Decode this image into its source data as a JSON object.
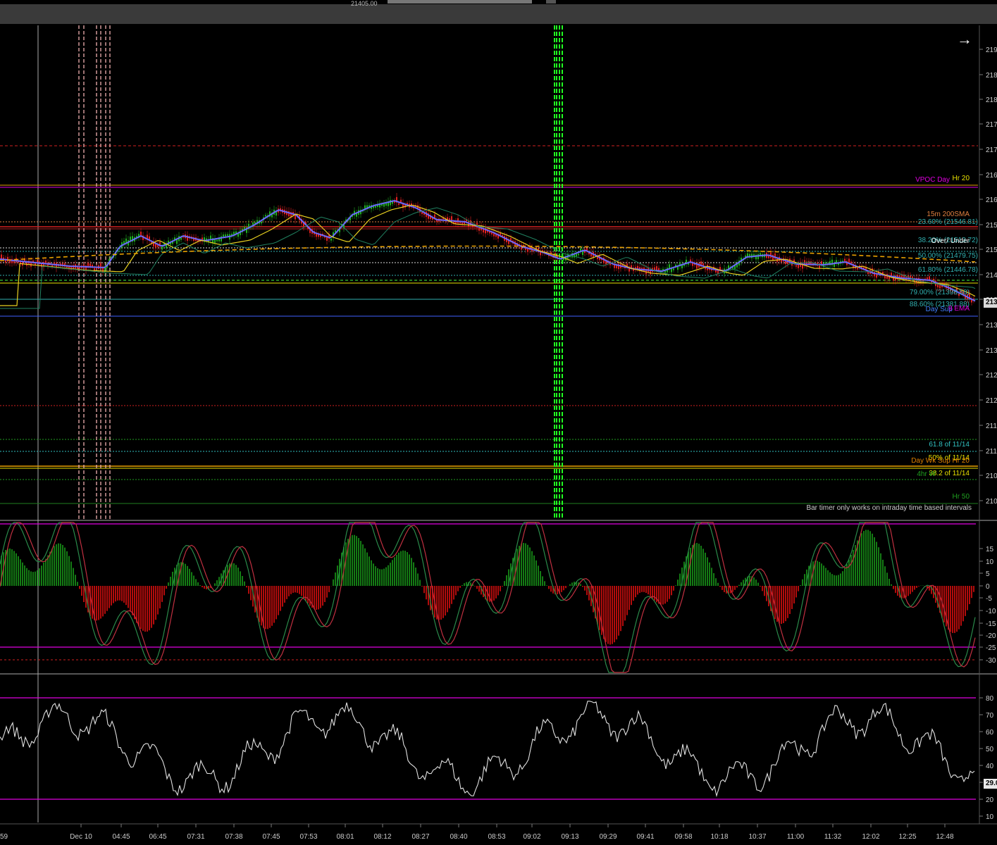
{
  "top_bar": {
    "price_readout": "21405.00"
  },
  "nav_arrow": "→",
  "bar_timer_notice": "Bar timer only works on intraday time based intervals",
  "price_badge": "213",
  "rsi_badge": "29.0",
  "left_edge_label": "59",
  "chart_data": [
    {
      "type": "line",
      "name": "price-panel",
      "y_axis_tick_labels": [
        "219",
        "218",
        "218",
        "217",
        "217",
        "216",
        "216",
        "215",
        "215",
        "214",
        "213",
        "213",
        "213",
        "212",
        "212",
        "211",
        "211",
        "210",
        "210"
      ],
      "price_level_labels": [
        {
          "text": "Hr 20",
          "color": "#e8e000"
        },
        {
          "text": "VPOC Day",
          "color": "#e000e0"
        },
        {
          "text": "15m 200SMA",
          "color": "#e08040"
        },
        {
          "text": "23.60% (21546.81)",
          "color": "#30b0b0"
        },
        {
          "text": "38.20% (21513.72)",
          "color": "#30b0b0"
        },
        {
          "text": "Over/ Under",
          "color": "#ffffff"
        },
        {
          "text": "50.00% (21479.75)",
          "color": "#30b0b0"
        },
        {
          "text": "61.80% (21446.78)",
          "color": "#30b0b0"
        },
        {
          "text": "79.00% (21398.58)",
          "color": "#30b0b0"
        },
        {
          "text": "88.60% (21381.88)",
          "color": "#30b0b0"
        },
        {
          "text": "Day Sup",
          "color": "#4080ff"
        },
        {
          "text": "9 EMA",
          "color": "#e000e0"
        },
        {
          "text": "61.8 of 11/14",
          "color": "#30c0c0"
        },
        {
          "text": "50% of 11/14",
          "color": "#e8e000"
        },
        {
          "text": "Day Wk Sup Hr 20",
          "color": "#e08000"
        },
        {
          "text": "38.2 of 11/14",
          "color": "#e8e000"
        },
        {
          "text": "4hr W",
          "color": "#20a020"
        },
        {
          "text": "Hr 50",
          "color": "#20a020"
        }
      ],
      "x_tick_labels": [
        "Dec 10",
        "04:45",
        "06:45",
        "07:31",
        "07:38",
        "07:45",
        "07:53",
        "08:01",
        "08:12",
        "08:27",
        "08:40",
        "08:53",
        "09:02",
        "09:13",
        "09:29",
        "09:41",
        "09:58",
        "10:18",
        "10:37",
        "11:00",
        "11:32",
        "12:02",
        "12:25",
        "12:48"
      ],
      "colors": {
        "bull": "#20b020",
        "bear": "#e02020",
        "fast_ema": "#6a6aff",
        "slow_ma": "#e8d020"
      }
    },
    {
      "type": "bar",
      "name": "momentum-histogram",
      "y_axis_tick_labels": [
        "15",
        "10",
        "5",
        "0",
        "-5",
        "-10",
        "-15",
        "-20",
        "-25",
        "-30"
      ],
      "ylim": [
        -35,
        20
      ],
      "colors": {
        "positive": "#1a9a1a",
        "negative": "#e01010"
      }
    },
    {
      "type": "line",
      "name": "rsi-oscillator",
      "y_axis_tick_labels": [
        "80",
        "70",
        "60",
        "50",
        "40",
        "30",
        "20",
        "10"
      ],
      "ylim": [
        5,
        90
      ],
      "bands": [
        80,
        20
      ],
      "colors": {
        "line": "#e0e0e0",
        "band": "#e000e0"
      }
    }
  ]
}
